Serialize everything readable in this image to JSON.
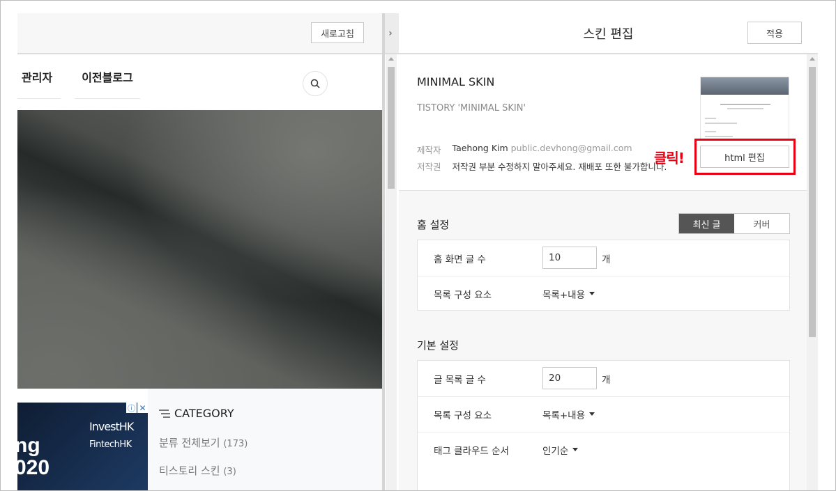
{
  "left_pane": {
    "refresh_label": "새로고침",
    "collapse_icon": "chevron-right-icon",
    "nav": {
      "tab_admin": "관리자",
      "tab_prev_blog": "이전블로그",
      "search_icon": "search-icon"
    },
    "ad": {
      "line1": "InvestHK",
      "line2": "FintechHK",
      "big_text": "ng\n020",
      "info_icon": "ⓘ",
      "close_icon": "✕"
    },
    "category": {
      "title": "CATEGORY",
      "items": [
        {
          "label": "분류 전체보기",
          "count": "(173)"
        },
        {
          "label": "티스토리 스킨",
          "count": "(3)"
        }
      ]
    }
  },
  "right_pane": {
    "title": "스킨 편집",
    "apply_label": "적용",
    "skin": {
      "name": "MINIMAL SKIN",
      "subtitle": "TISTORY 'MINIMAL SKIN'",
      "author_label": "제작자",
      "author_name": "Taehong Kim",
      "author_email": "public.devhong@gmail.com",
      "copyright_label": "저작권",
      "copyright_text": "저작권 부분 수정하지 말아주세요. 재배포 또한 불가합니다.",
      "html_edit_label": "html 편집",
      "click_note": "클릭!"
    },
    "home_settings": {
      "title": "홈 설정",
      "toggle": {
        "latest": "최신 글",
        "cover": "커버",
        "selected": "latest"
      },
      "rows": [
        {
          "label": "홈 화면 글 수",
          "value": "10",
          "unit": "개"
        },
        {
          "label": "목록 구성 요소",
          "value": "목록+내용"
        }
      ]
    },
    "basic_settings": {
      "title": "기본 설정",
      "rows": [
        {
          "label": "글 목록 글 수",
          "value": "20",
          "unit": "개"
        },
        {
          "label": "목록 구성 요소",
          "value": "목록+내용"
        },
        {
          "label": "태그 클라우드 순서",
          "value": "인기순"
        }
      ]
    }
  },
  "colors": {
    "highlight": "#e60012",
    "toggle_active": "#555555"
  }
}
